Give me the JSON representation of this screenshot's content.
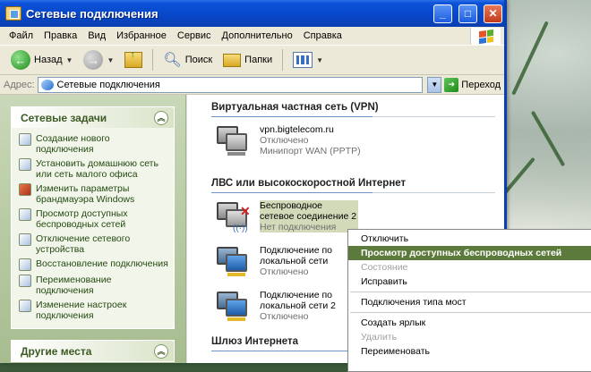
{
  "window": {
    "title": "Сетевые подключения",
    "minimize": "_",
    "maximize": "□",
    "close": "✕"
  },
  "menu": [
    "Файл",
    "Правка",
    "Вид",
    "Избранное",
    "Сервис",
    "Дополнительно",
    "Справка"
  ],
  "toolbar": {
    "back": "Назад",
    "search": "Поиск",
    "folders": "Папки"
  },
  "address": {
    "label": "Адрес:",
    "value": "Сетевые подключения",
    "go": "Переход"
  },
  "sidebar": {
    "tasks_title": "Сетевые задачи",
    "tasks": [
      "Создание нового подключения",
      "Установить домашнюю сеть или сеть малого офиса",
      "Изменить параметры брандмауэра Windows",
      "Просмотр доступных беспроводных сетей",
      "Отключение сетевого устройства",
      "Восстановление подключения",
      "Переименование подключения",
      "Изменение настроек подключения"
    ],
    "other_title": "Другие места"
  },
  "groups": {
    "vpn": "Виртуальная частная сеть (VPN)",
    "lan": "ЛВС или высокоскоростной Интернет",
    "gateway": "Шлюз Интернета"
  },
  "connections": [
    {
      "name": "vpn.bigtelecom.ru",
      "status": "Отключено",
      "device": "Минипорт WAN (PPTP)"
    },
    {
      "name": "Беспроводное сетевое соединение 2",
      "status": "Нет подключения"
    },
    {
      "name": "Подключение по локальной сети",
      "status": "Отключено"
    },
    {
      "name": "Подключение по локальной сети 2",
      "status": "Отключено"
    }
  ],
  "context_menu": [
    "Отключить",
    "Просмотр доступных беспроводных сетей",
    "Состояние",
    "Исправить",
    "Подключения типа мост",
    "Создать ярлык",
    "Удалить",
    "Переименовать"
  ],
  "colors": {
    "titlebar": "#0a52d8",
    "sidebar": "#b8cba3",
    "highlight": "#5c7a3c"
  }
}
